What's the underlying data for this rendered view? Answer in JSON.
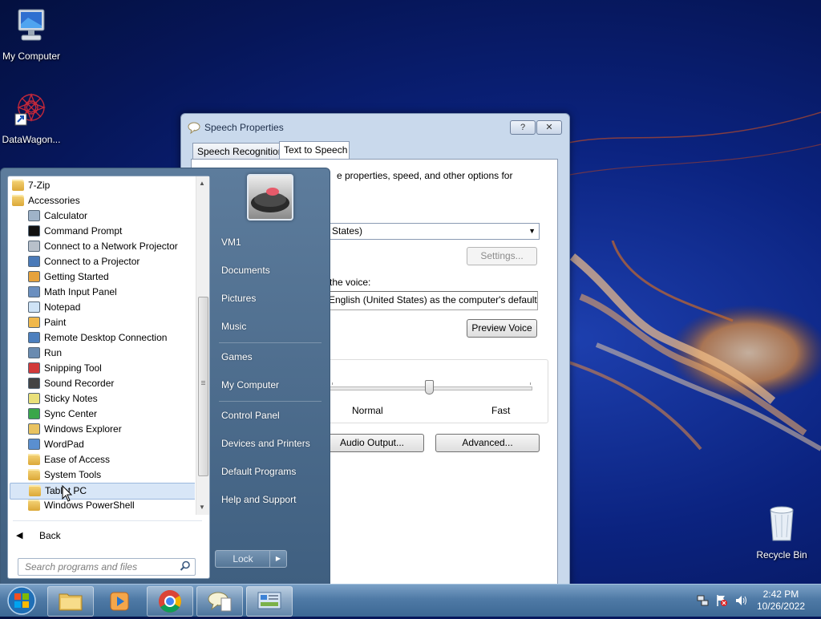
{
  "desktop": {
    "icons": {
      "my_computer": "My Computer",
      "datawagon": "DataWagon...",
      "recycle_bin": "Recycle Bin"
    }
  },
  "dialog": {
    "title": "Speech Properties",
    "help_btn": "?",
    "close_btn": "✕",
    "tabs": [
      "Speech Recognition",
      "Text to Speech"
    ],
    "active_tab": "Text to Speech",
    "intro_text": "e properties, speed, and other options for",
    "voice_select": "d States)",
    "settings_button": "Settings...",
    "preview_label": "w the voice:",
    "preview_text": "English (United States) as the computer's default voice.",
    "preview_button": "Preview Voice",
    "speed": {
      "label_normal": "Normal",
      "label_fast": "Fast",
      "value": 0.5
    },
    "audio_output_button": "Audio Output...",
    "advanced_button": "Advanced..."
  },
  "start_menu": {
    "programs": [
      {
        "label": "7-Zip",
        "icon": "folder-icon",
        "indent": 0
      },
      {
        "label": "Accessories",
        "icon": "folder-icon",
        "indent": 0
      },
      {
        "label": "Calculator",
        "icon": "calculator-icon",
        "indent": 1
      },
      {
        "label": "Command Prompt",
        "icon": "command-prompt-icon",
        "indent": 1
      },
      {
        "label": "Connect to a Network Projector",
        "icon": "network-projector-icon",
        "indent": 1
      },
      {
        "label": "Connect to a Projector",
        "icon": "projector-icon",
        "indent": 1
      },
      {
        "label": "Getting Started",
        "icon": "getting-started-icon",
        "indent": 1
      },
      {
        "label": "Math Input Panel",
        "icon": "math-input-icon",
        "indent": 1
      },
      {
        "label": "Notepad",
        "icon": "notepad-icon",
        "indent": 1
      },
      {
        "label": "Paint",
        "icon": "paint-icon",
        "indent": 1
      },
      {
        "label": "Remote Desktop Connection",
        "icon": "remote-desktop-icon",
        "indent": 1
      },
      {
        "label": "Run",
        "icon": "run-icon",
        "indent": 1
      },
      {
        "label": "Snipping Tool",
        "icon": "snipping-tool-icon",
        "indent": 1
      },
      {
        "label": "Sound Recorder",
        "icon": "microphone-icon",
        "indent": 1
      },
      {
        "label": "Sticky Notes",
        "icon": "sticky-notes-icon",
        "indent": 1
      },
      {
        "label": "Sync Center",
        "icon": "sync-center-icon",
        "indent": 1
      },
      {
        "label": "Windows Explorer",
        "icon": "explorer-icon",
        "indent": 1
      },
      {
        "label": "WordPad",
        "icon": "wordpad-icon",
        "indent": 1
      },
      {
        "label": "Ease of Access",
        "icon": "folder-icon",
        "indent": 1
      },
      {
        "label": "System Tools",
        "icon": "folder-icon",
        "indent": 1
      },
      {
        "label": "Tablet PC",
        "icon": "folder-icon",
        "indent": 1,
        "selected": true
      },
      {
        "label": "Windows PowerShell",
        "icon": "folder-icon",
        "indent": 1
      }
    ],
    "back_label": "Back",
    "search_placeholder": "Search programs and files",
    "right_links": [
      "VM1",
      "Documents",
      "Pictures",
      "Music",
      "Games",
      "My Computer",
      "Control Panel",
      "Devices and Printers",
      "Default Programs",
      "Help and Support"
    ],
    "lock_label": "Lock"
  },
  "taskbar": {
    "time": "2:42 PM",
    "date": "10/26/2022"
  }
}
